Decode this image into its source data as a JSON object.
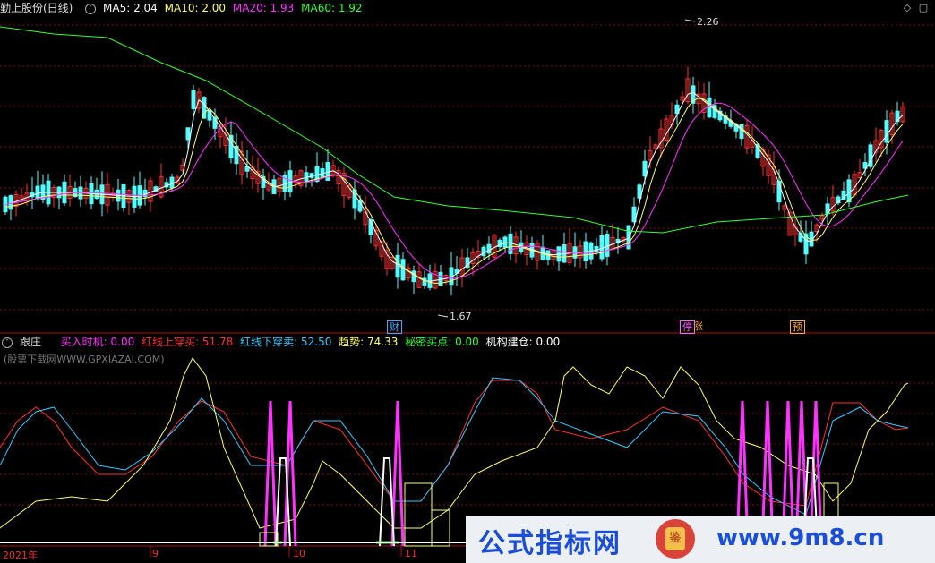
{
  "main_chart": {
    "title": "勤上股份(日线)",
    "indicators": [
      {
        "label": "MA5: 2.04",
        "color": "#ffffff"
      },
      {
        "label": "MA10: 2.00",
        "color": "#ffff66"
      },
      {
        "label": "MA20: 1.93",
        "color": "#ff33ff"
      },
      {
        "label": "MA60: 1.92",
        "color": "#33ff33"
      }
    ],
    "high_label": "2.26",
    "low_label": "1.67",
    "event_tags": [
      {
        "text": "财",
        "color": "#44aaff"
      },
      {
        "text": "停",
        "color": "#ff66ff"
      },
      {
        "text": "涨",
        "color": "#ffaa33"
      },
      {
        "text": "预",
        "color": "#ffaa33"
      }
    ]
  },
  "sub_chart": {
    "title": "跟庄",
    "watermark": "(股票下载网WWW.GPXIAZAI.COM)",
    "indicators": [
      {
        "label": "买入时机: 0.00",
        "color": "#ff33ff"
      },
      {
        "label": "红线上穿买: 51.78",
        "color": "#ff3333"
      },
      {
        "label": "红线下穿卖: 52.50",
        "color": "#33ccff"
      },
      {
        "label": "趋势: 74.33",
        "color": "#ffff66"
      },
      {
        "label": "秘密买点: 0.00",
        "color": "#33ff33"
      },
      {
        "label": "机构建仓: 0.00",
        "color": "#ffffff"
      }
    ]
  },
  "x_axis": {
    "labels": [
      "2021年",
      "9",
      "10",
      "11"
    ]
  },
  "banner": {
    "left_text": "公式指标网",
    "logo_text": "鉴",
    "right_text": "www.9m8.cn"
  },
  "colors": {
    "up": "#ff3232",
    "down": "#54ffff",
    "grid": "#7a1010",
    "background": "#000000"
  }
}
